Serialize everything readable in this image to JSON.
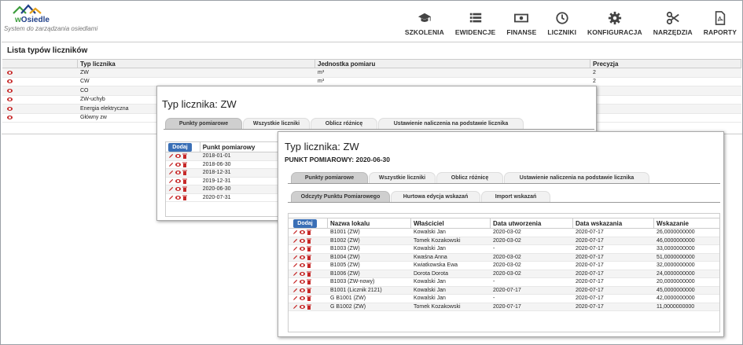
{
  "logo": {
    "brand_a": "w",
    "brand_b": "Osiedle",
    "tagline": "System do zarządzania osiedlami"
  },
  "nav": [
    {
      "label": "SZKOLENIA",
      "icon": "graduation-cap-icon"
    },
    {
      "label": "EWIDENCJE",
      "icon": "list-icon"
    },
    {
      "label": "FINANSE",
      "icon": "money-icon"
    },
    {
      "label": "LICZNIKI",
      "icon": "clock-icon"
    },
    {
      "label": "KONFIGURACJA",
      "icon": "gear-icon"
    },
    {
      "label": "NARZĘDZIA",
      "icon": "scissors-icon"
    },
    {
      "label": "RAPORTY",
      "icon": "pdf-icon"
    }
  ],
  "meter_types": {
    "title": "Lista typów liczników",
    "columns": [
      "Typ licznika",
      "Jednostka pomiaru",
      "Precyzja"
    ],
    "rows": [
      {
        "type": "ZW",
        "unit": "m³",
        "precision": "2"
      },
      {
        "type": "CW",
        "unit": "m³",
        "precision": "2"
      },
      {
        "type": "CO",
        "unit": "",
        "precision": ""
      },
      {
        "type": "ZW-uchyb",
        "unit": "",
        "precision": ""
      },
      {
        "type": "Energia elektryczna",
        "unit": "",
        "precision": ""
      },
      {
        "type": "Główny zw",
        "unit": "",
        "precision": ""
      }
    ]
  },
  "dialog1": {
    "title_label": "Typ licznika:",
    "title_value": "ZW",
    "tabs": [
      "Punkty pomiarowe",
      "Wszystkie liczniki",
      "Oblicz różnicę",
      "Ustawienie naliczenia na podstawie licznika"
    ],
    "add_label": "Dodaj",
    "column": "Punkt pomiarowy",
    "rows": [
      "2018-01-01",
      "2018-06-30",
      "2018-12-31",
      "2019-12-31",
      "2020-06-30",
      "2020-07-31"
    ]
  },
  "dialog2": {
    "title_label": "Typ licznika:",
    "title_value": "ZW",
    "subtitle": "PUNKT POMIAROWY: 2020-06-30",
    "tabs": [
      "Punkty pomiarowe",
      "Wszystkie liczniki",
      "Oblicz różnicę",
      "Ustawienie naliczenia na podstawie licznika"
    ],
    "subtabs": [
      "Odczyty Punktu Pomiarowego",
      "Hurtowa edycja wskazań",
      "Import wskazań"
    ],
    "add_label": "Dodaj",
    "columns": [
      "Nazwa lokalu",
      "Właściciel",
      "Data utworzenia",
      "Data wskazania",
      "Wskazanie"
    ],
    "rows": [
      {
        "unit": "B1001 (ZW)",
        "owner": "Kowalski Jan",
        "created": "2020-03-02",
        "reading_date": "2020-07-17",
        "value": "26,0000000000"
      },
      {
        "unit": "B1002 (ZW)",
        "owner": "Tomek Kozakowski",
        "created": "2020-03-02",
        "reading_date": "2020-07-17",
        "value": "46,0000000000"
      },
      {
        "unit": "B1003 (ZW)",
        "owner": "Kowalski Jan",
        "created": "-",
        "reading_date": "2020-07-17",
        "value": "33,0000000000"
      },
      {
        "unit": "B1004 (ZW)",
        "owner": "Kwaśna Anna",
        "created": "2020-03-02",
        "reading_date": "2020-07-17",
        "value": "51,0000000000"
      },
      {
        "unit": "B1005 (ZW)",
        "owner": "Kwiatkowska Ewa",
        "created": "2020-03-02",
        "reading_date": "2020-07-17",
        "value": "32,0000000000"
      },
      {
        "unit": "B1006 (ZW)",
        "owner": "Dorota Dorota",
        "created": "2020-03-02",
        "reading_date": "2020-07-17",
        "value": "24,0000000000"
      },
      {
        "unit": "B1003 (ZW-nowy)",
        "owner": "Kowalski Jan",
        "created": "-",
        "reading_date": "2020-07-17",
        "value": "20,0000000000"
      },
      {
        "unit": "B1001 (Licznik 2121)",
        "owner": "Kowalski Jan",
        "created": "2020-07-17",
        "reading_date": "2020-07-17",
        "value": "45,0000000000"
      },
      {
        "unit": "G B1001 (ZW)",
        "owner": "Kowalski Jan",
        "created": "-",
        "reading_date": "2020-07-17",
        "value": "42,0000000000"
      },
      {
        "unit": "G B1002 (ZW)",
        "owner": "Tomek Kozakowski",
        "created": "2020-07-17",
        "reading_date": "2020-07-17",
        "value": "11,0000000000"
      }
    ]
  },
  "colors": {
    "accent": "#3a6fb6",
    "icon_red": "#c62828"
  }
}
